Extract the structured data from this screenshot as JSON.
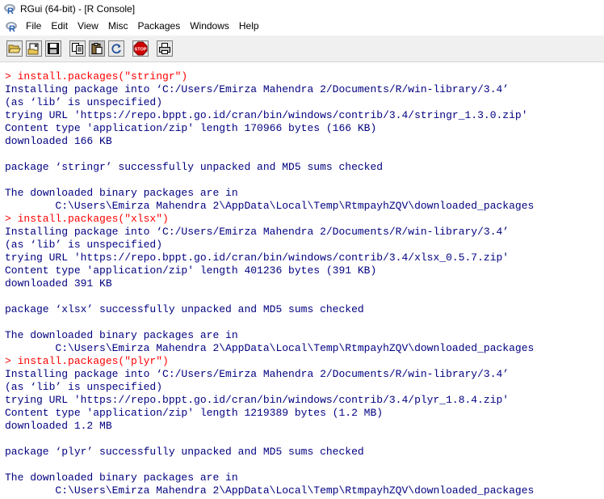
{
  "window": {
    "title": "RGui (64-bit) - [R Console]"
  },
  "menu": {
    "items": [
      "File",
      "Edit",
      "View",
      "Misc",
      "Packages",
      "Windows",
      "Help"
    ]
  },
  "toolbar": {
    "buttons": [
      {
        "name": "open-script-button",
        "icon": "folder-open-icon"
      },
      {
        "name": "load-workspace-button",
        "icon": "load-workspace-icon"
      },
      {
        "name": "save-workspace-button",
        "icon": "floppy-disk-icon"
      },
      {
        "name": "copy-button",
        "icon": "copy-icon"
      },
      {
        "name": "paste-button",
        "icon": "paste-icon"
      },
      {
        "name": "copy-paste-button",
        "icon": "refresh-icon"
      },
      {
        "name": "stop-button",
        "icon": "stop-icon",
        "label": "STOP"
      },
      {
        "name": "print-button",
        "icon": "printer-icon"
      }
    ]
  },
  "colors": {
    "command": "#ff0000",
    "output": "#000080"
  },
  "console": {
    "lines": [
      {
        "type": "cmd",
        "text": "> install.packages(\"stringr\")"
      },
      {
        "type": "out",
        "text": "Installing package into ‘C:/Users/Emirza Mahendra 2/Documents/R/win-library/3.4’"
      },
      {
        "type": "out",
        "text": "(as ‘lib’ is unspecified)"
      },
      {
        "type": "out",
        "text": "trying URL 'https://repo.bppt.go.id/cran/bin/windows/contrib/3.4/stringr_1.3.0.zip'"
      },
      {
        "type": "out",
        "text": "Content type 'application/zip' length 170966 bytes (166 KB)"
      },
      {
        "type": "out",
        "text": "downloaded 166 KB"
      },
      {
        "type": "out",
        "text": ""
      },
      {
        "type": "out",
        "text": "package ‘stringr’ successfully unpacked and MD5 sums checked"
      },
      {
        "type": "out",
        "text": ""
      },
      {
        "type": "out",
        "text": "The downloaded binary packages are in"
      },
      {
        "type": "out",
        "text": "        C:\\Users\\Emirza Mahendra 2\\AppData\\Local\\Temp\\RtmpayhZQV\\downloaded_packages"
      },
      {
        "type": "cmd",
        "text": "> install.packages(\"xlsx\")"
      },
      {
        "type": "out",
        "text": "Installing package into ‘C:/Users/Emirza Mahendra 2/Documents/R/win-library/3.4’"
      },
      {
        "type": "out",
        "text": "(as ‘lib’ is unspecified)"
      },
      {
        "type": "out",
        "text": "trying URL 'https://repo.bppt.go.id/cran/bin/windows/contrib/3.4/xlsx_0.5.7.zip'"
      },
      {
        "type": "out",
        "text": "Content type 'application/zip' length 401236 bytes (391 KB)"
      },
      {
        "type": "out",
        "text": "downloaded 391 KB"
      },
      {
        "type": "out",
        "text": ""
      },
      {
        "type": "out",
        "text": "package ‘xlsx’ successfully unpacked and MD5 sums checked"
      },
      {
        "type": "out",
        "text": ""
      },
      {
        "type": "out",
        "text": "The downloaded binary packages are in"
      },
      {
        "type": "out",
        "text": "        C:\\Users\\Emirza Mahendra 2\\AppData\\Local\\Temp\\RtmpayhZQV\\downloaded_packages"
      },
      {
        "type": "cmd",
        "text": "> install.packages(\"plyr\")"
      },
      {
        "type": "out",
        "text": "Installing package into ‘C:/Users/Emirza Mahendra 2/Documents/R/win-library/3.4’"
      },
      {
        "type": "out",
        "text": "(as ‘lib’ is unspecified)"
      },
      {
        "type": "out",
        "text": "trying URL 'https://repo.bppt.go.id/cran/bin/windows/contrib/3.4/plyr_1.8.4.zip'"
      },
      {
        "type": "out",
        "text": "Content type 'application/zip' length 1219389 bytes (1.2 MB)"
      },
      {
        "type": "out",
        "text": "downloaded 1.2 MB"
      },
      {
        "type": "out",
        "text": ""
      },
      {
        "type": "out",
        "text": "package ‘plyr’ successfully unpacked and MD5 sums checked"
      },
      {
        "type": "out",
        "text": ""
      },
      {
        "type": "out",
        "text": "The downloaded binary packages are in"
      },
      {
        "type": "out",
        "text": "        C:\\Users\\Emirza Mahendra 2\\AppData\\Local\\Temp\\RtmpayhZQV\\downloaded_packages"
      }
    ]
  }
}
